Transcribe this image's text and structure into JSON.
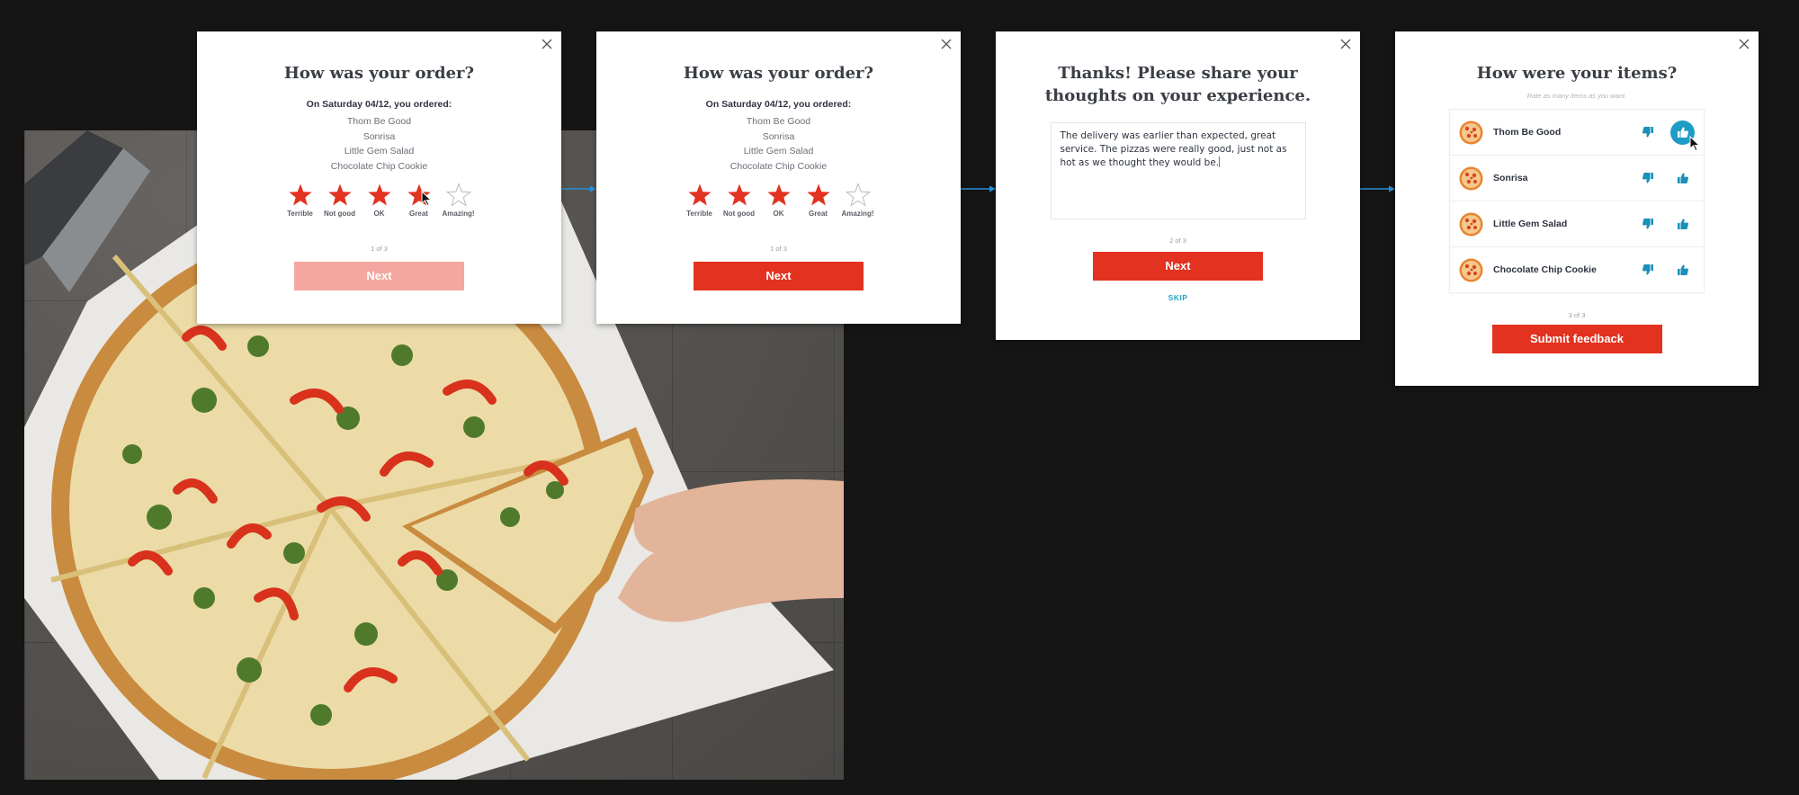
{
  "colors": {
    "accent": "#e3321f",
    "accent_disabled": "#f3a7a0",
    "link": "#2aa1c0",
    "thumb_active": "#1f9cc4",
    "flow_line": "#2a8fd8"
  },
  "step1": {
    "title": "How was your order?",
    "subhead": "On Saturday 04/12, you ordered:",
    "items": [
      "Thom Be Good",
      "Sonrisa",
      "Little Gem Salad",
      "Chocolate Chip Cookie"
    ],
    "stars": [
      {
        "label": "Terrible",
        "filled": true
      },
      {
        "label": "Not good",
        "filled": true
      },
      {
        "label": "OK",
        "filled": true
      },
      {
        "label": "Great",
        "filled": true
      },
      {
        "label": "Amazing!",
        "filled": false
      }
    ],
    "rating": 4,
    "pager": "1 of 3",
    "next_label": "Next"
  },
  "step2": {
    "title": "How was your order?",
    "subhead": "On Saturday 04/12, you ordered:",
    "items": [
      "Thom Be Good",
      "Sonrisa",
      "Little Gem Salad",
      "Chocolate Chip Cookie"
    ],
    "stars": [
      {
        "label": "Terrible",
        "filled": true
      },
      {
        "label": "Not good",
        "filled": true
      },
      {
        "label": "OK",
        "filled": true
      },
      {
        "label": "Great",
        "filled": true
      },
      {
        "label": "Amazing!",
        "filled": false
      }
    ],
    "rating": 4,
    "pager": "1 of 3",
    "next_label": "Next"
  },
  "step3": {
    "title_line1": "Thanks! Please share your",
    "title_line2": "thoughts on your experience.",
    "comment": "The delivery was earlier than expected, great service. The pizzas were really good, just not as hot as we thought they would be.",
    "pager": "2 of 3",
    "next_label": "Next",
    "skip_label": "SKIP"
  },
  "step4": {
    "title": "How were your items?",
    "hint": "Rate as many items as you want.",
    "items": [
      {
        "name": "Thom Be Good",
        "icon": "pizza-icon",
        "thumbs_up_selected": true
      },
      {
        "name": "Sonrisa",
        "icon": "pizza-icon",
        "thumbs_up_selected": false
      },
      {
        "name": "Little Gem Salad",
        "icon": "pizza-icon",
        "thumbs_up_selected": false
      },
      {
        "name": "Chocolate Chip Cookie",
        "icon": "pizza-icon",
        "thumbs_up_selected": false
      }
    ],
    "pager": "3 of 3",
    "submit_label": "Submit feedback"
  }
}
